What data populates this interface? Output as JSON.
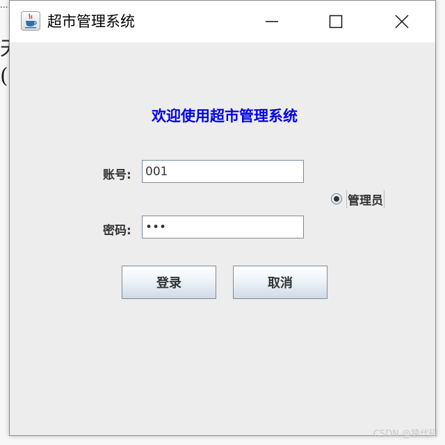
{
  "background_app": {
    "text_1": "...",
    "text_2": "天",
    "text_3": "("
  },
  "window": {
    "title": "超市管理系统",
    "icon": "java-cup-icon"
  },
  "title_controls": {
    "minimize_icon": "minimize-icon",
    "maximize_icon": "maximize-icon",
    "close_icon": "close-icon"
  },
  "form": {
    "welcome_text": "欢迎使用超市管理系统",
    "account_label": "账号:",
    "account_value": "001",
    "password_label": "密码:",
    "password_value": "•••",
    "role_option_label": "管理员",
    "role_option_selected": true,
    "login_button": "登录",
    "cancel_button": "取消"
  },
  "colors": {
    "welcome_text": "#0000e6",
    "window_background": "#ededed",
    "titlebar_background": "#ffffff"
  },
  "watermark": "CSDN @猿代码"
}
